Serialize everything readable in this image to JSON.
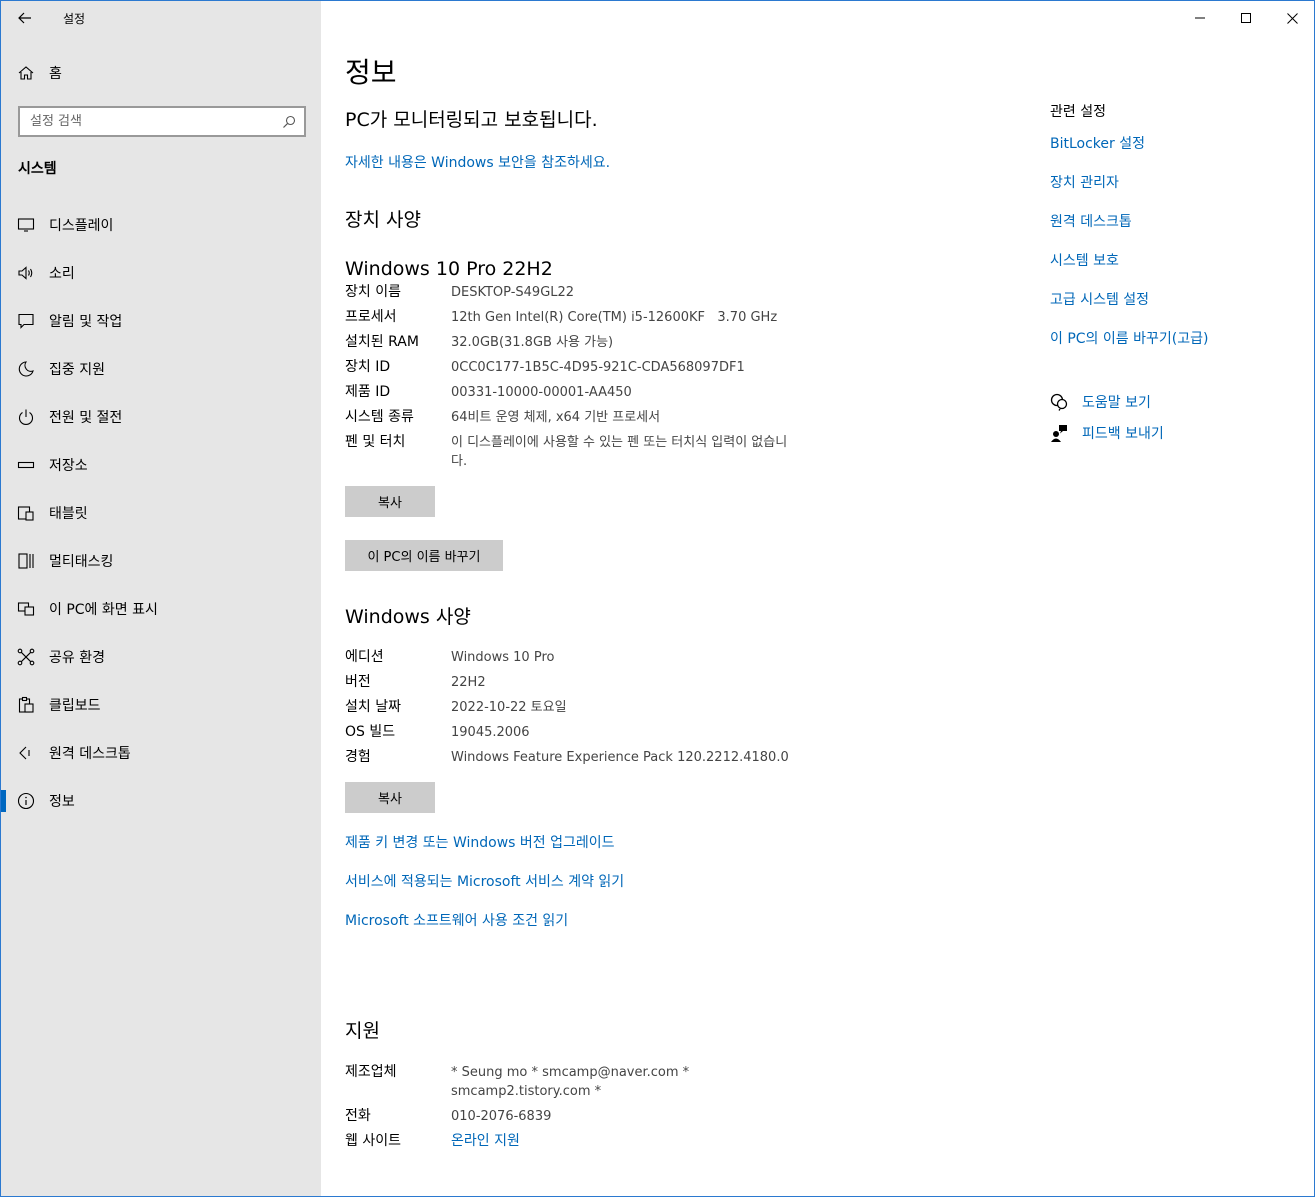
{
  "window": {
    "app_title": "설정",
    "back_label": "←",
    "colors": {
      "accent": "#0067b8",
      "sidebar": "#e6e6e6",
      "button": "#cccccc"
    }
  },
  "sidebar": {
    "home_label": "홈",
    "search_placeholder": "설정 검색",
    "section_title": "시스템",
    "items": [
      {
        "label": "디스플레이",
        "icon": "display-icon"
      },
      {
        "label": "소리",
        "icon": "speaker-icon"
      },
      {
        "label": "알림 및 작업",
        "icon": "notification-icon"
      },
      {
        "label": "집중 지원",
        "icon": "moon-icon"
      },
      {
        "label": "전원 및 절전",
        "icon": "power-icon"
      },
      {
        "label": "저장소",
        "icon": "storage-icon"
      },
      {
        "label": "태블릿",
        "icon": "tablet-icon"
      },
      {
        "label": "멀티태스킹",
        "icon": "multitasking-icon"
      },
      {
        "label": "이 PC에 화면 표시",
        "icon": "project-icon"
      },
      {
        "label": "공유 환경",
        "icon": "share-icon"
      },
      {
        "label": "클립보드",
        "icon": "clipboard-icon"
      },
      {
        "label": "원격 데스크톱",
        "icon": "remote-desktop-icon"
      },
      {
        "label": "정보",
        "icon": "info-icon",
        "active": true
      }
    ]
  },
  "main": {
    "title": "정보",
    "protection_status": "PC가 모니터링되고 보호됩니다.",
    "security_link": "자세한 내용은 Windows 보안을 참조하세요.",
    "device_specs": {
      "heading": "장치 사양",
      "edition_title": "Windows 10 Pro 22H2",
      "rows": [
        {
          "label": "장치 이름",
          "value": "DESKTOP-S49GL22"
        },
        {
          "label": "프로세서",
          "value": "12th Gen Intel(R) Core(TM) i5-12600KF   3.70 GHz"
        },
        {
          "label": "설치된 RAM",
          "value": "32.0GB(31.8GB 사용 가능)"
        },
        {
          "label": "장치 ID",
          "value": "0CC0C177-1B5C-4D95-921C-CDA568097DF1"
        },
        {
          "label": "제품 ID",
          "value": "00331-10000-00001-AA450"
        },
        {
          "label": "시스템 종류",
          "value": "64비트 운영 체제, x64 기반 프로세서"
        },
        {
          "label": "펜 및 터치",
          "value": "이 디스플레이에 사용할 수 있는 펜 또는 터치식 입력이 없습니다."
        }
      ],
      "copy_button": "복사",
      "rename_button": "이 PC의 이름 바꾸기"
    },
    "windows_specs": {
      "heading": "Windows 사양",
      "rows": [
        {
          "label": "에디션",
          "value": "Windows 10 Pro"
        },
        {
          "label": "버전",
          "value": "22H2"
        },
        {
          "label": "설치 날짜",
          "value": "2022-10-22 토요일"
        },
        {
          "label": "OS 빌드",
          "value": "19045.2006"
        },
        {
          "label": "경험",
          "value": "Windows Feature Experience Pack 120.2212.4180.0"
        }
      ],
      "copy_button": "복사",
      "links": [
        "제품 키 변경 또는 Windows 버전 업그레이드",
        "서비스에 적용되는 Microsoft 서비스 계약 읽기",
        "Microsoft 소프트웨어 사용 조건 읽기"
      ]
    },
    "support": {
      "heading": "지원",
      "manufacturer_label": "제조업체",
      "manufacturer_value": "* Seung mo * smcamp@naver.com * smcamp2.tistory.com *",
      "phone_label": "전화",
      "phone_value": "010-2076-6839",
      "website_label": "웹 사이트",
      "website_value": "온라인 지원"
    }
  },
  "related": {
    "heading": "관련 설정",
    "links": [
      "BitLocker 설정",
      "장치 관리자",
      "원격 데스크톱",
      "시스템 보호",
      "고급 시스템 설정",
      "이 PC의 이름 바꾸기(고급)"
    ],
    "help_label": "도움말 보기",
    "feedback_label": "피드백 보내기"
  }
}
